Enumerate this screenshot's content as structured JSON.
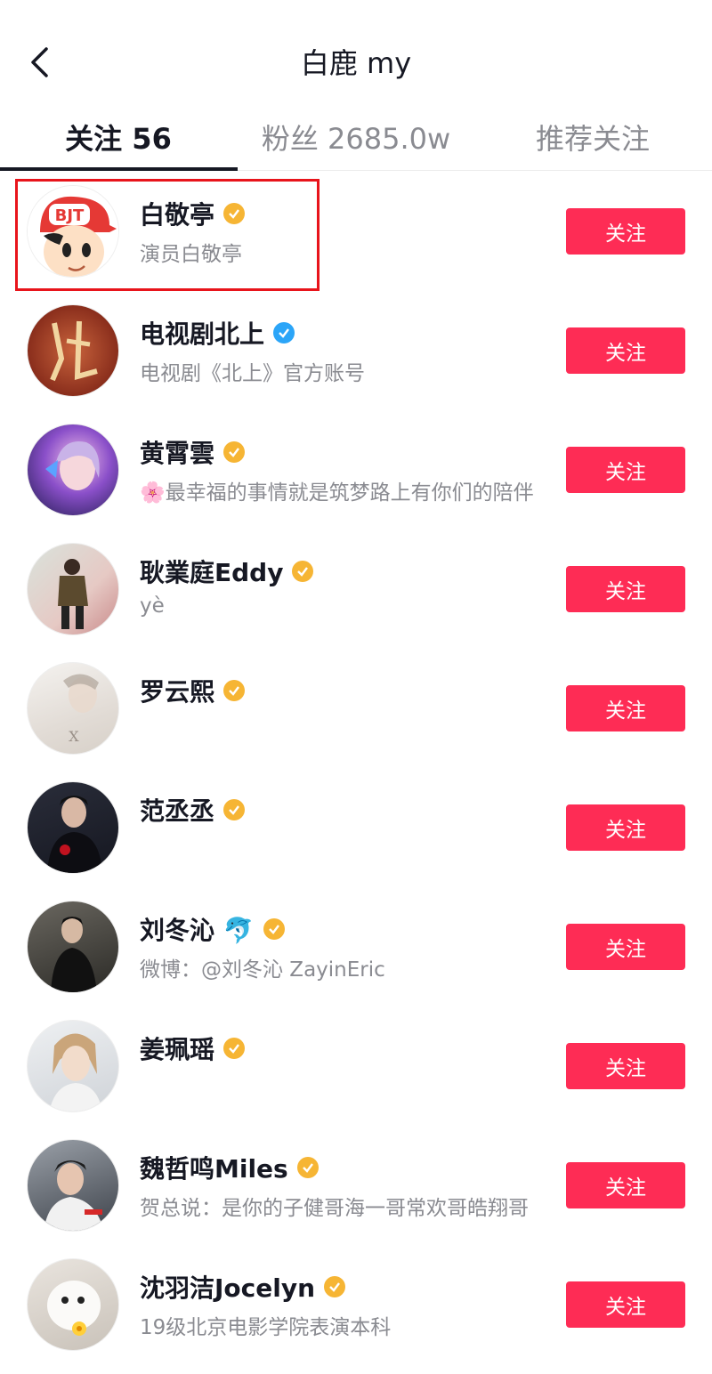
{
  "header": {
    "title": "白鹿 my",
    "back_icon": "chevron-left-icon"
  },
  "tabs": [
    {
      "label": "关注 56",
      "active": true
    },
    {
      "label": "粉丝 2685.0w",
      "active": false
    },
    {
      "label": "推荐关注",
      "active": false
    }
  ],
  "colors": {
    "follow_button": "#fe2c55",
    "verified_gold": "#f6b534",
    "verified_blue": "#2ba5f8",
    "highlight": "#e8141b"
  },
  "users": [
    {
      "name": "白敬亭",
      "verified": "gold",
      "desc": "演员白敬亭",
      "follow_label": "关注"
    },
    {
      "name": "电视剧北上",
      "verified": "blue",
      "desc": "电视剧《北上》官方账号",
      "follow_label": "关注"
    },
    {
      "name": "黄霄雲",
      "verified": "gold",
      "desc": "🌸最幸福的事情就是筑梦路上有你们的陪伴",
      "follow_label": "关注"
    },
    {
      "name": "耿業庭Eddy",
      "verified": "gold",
      "desc": "yè",
      "follow_label": "关注"
    },
    {
      "name": "罗云熙",
      "verified": "gold",
      "desc": "",
      "follow_label": "关注"
    },
    {
      "name": "范丞丞",
      "verified": "gold",
      "desc": "",
      "follow_label": "关注"
    },
    {
      "name": "刘冬沁 🐬",
      "verified": "gold",
      "desc": "微博：@刘冬沁 ZayinEric",
      "follow_label": "关注"
    },
    {
      "name": "姜珮瑶",
      "verified": "gold",
      "desc": "",
      "follow_label": "关注"
    },
    {
      "name": "魏哲鸣Miles",
      "verified": "gold",
      "desc": "贺总说：是你的子健哥海一哥常欢哥皓翔哥",
      "follow_label": "关注"
    },
    {
      "name": "沈羽洁Jocelyn",
      "verified": "gold",
      "desc": "19级北京电影学院表演本科",
      "follow_label": "关注"
    }
  ]
}
